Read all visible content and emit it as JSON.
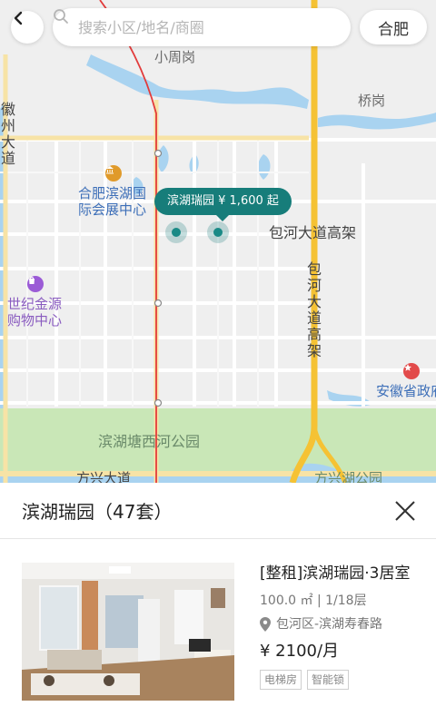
{
  "map": {
    "labels": {
      "xiaozhougang": "小周岗",
      "qiaogang": "桥岗",
      "huizhou_avenue": "徽州大道",
      "binhu_convention": "合肥滨湖国际会展中心",
      "binhu_convention_l1": "合肥滨湖国",
      "binhu_convention_l2": "际会展中心",
      "baohe_elevated": "包河大道高架",
      "baohe_elevated_vertical": "包河大道高架",
      "century_jinyuan_l1": "世纪金源",
      "century_jinyuan_l2": "购物中心",
      "anhui_gov": "安徽省政府",
      "binhu_park": "滨湖塘西河公园",
      "fangxing_avenue": "方兴大道",
      "fangxing_lake_park": "方兴湖公园"
    },
    "bubble": "滨湖瑞园  ¥ 1,600 起"
  },
  "header": {
    "search_placeholder": "搜索小区/地名/商圈",
    "city": "合肥"
  },
  "sheet": {
    "title": "滨湖瑞园（47套）",
    "listing": {
      "title": "[整租]滨湖瑞园·3居室",
      "meta": "100.0 ㎡ | 1/18层",
      "location": "包河区-滨湖寿春路",
      "price": "¥ 2100/月",
      "tags": [
        "电梯房",
        "智能锁"
      ]
    }
  },
  "colors": {
    "accent": "#177d7a",
    "road_major": "#f5c234",
    "water": "#a9d3f0",
    "park": "#c9e7b7"
  }
}
